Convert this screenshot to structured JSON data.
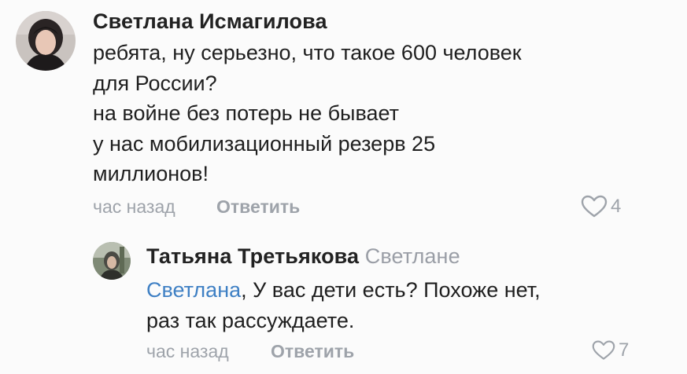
{
  "comments": [
    {
      "author": "Светлана Исмагилова",
      "lines": [
        "ребята, ну серьезно, что такое 600 человек",
        "для России?",
        "на войне без потерь не бывает",
        "у нас мобилизационный резерв 25",
        "миллионов!"
      ],
      "time": "час назад",
      "reply_label": "Ответить",
      "likes": "4",
      "avatar_icon": "user-avatar-photo"
    },
    {
      "author": "Татьяна Третьякова",
      "reply_to": "Светлане",
      "mention": "Светлана",
      "text_after_mention": ", У вас дети есть? Похоже нет,",
      "line2": "раз так рассуждаете.",
      "time": "час назад",
      "reply_label": "Ответить",
      "likes": "7",
      "avatar_icon": "user-avatar-photo"
    }
  ],
  "icons": {
    "like": "heart-outline-icon"
  },
  "colors": {
    "mention": "#3f80c4",
    "meta": "#9ea3aa",
    "author": "#222222"
  }
}
